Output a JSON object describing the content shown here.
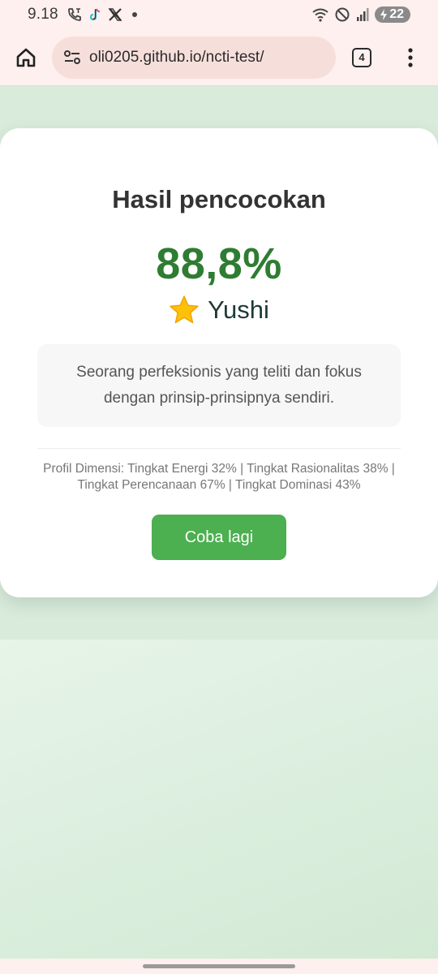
{
  "status_bar": {
    "time": "9.18",
    "battery": "22",
    "left_icons": [
      "call-icon",
      "tiktok-icon",
      "x-icon",
      "dot-icon"
    ],
    "right_icons": [
      "wifi-icon",
      "do-not-disturb-icon",
      "signal-icon",
      "battery-icon"
    ]
  },
  "browser": {
    "url": "oli0205.github.io/ncti-test/",
    "tab_count": "4"
  },
  "result": {
    "title": "Hasil pencocokan",
    "score": "88,8%",
    "name": "Yushi",
    "description": "Seorang perfeksionis yang teliti dan fokus dengan prinsip-prinsipnya sendiri.",
    "profile": "Profil Dimensi: Tingkat Energi 32% | Tingkat Rasionalitas 38% | Tingkat Perencanaan 67% | Tingkat Dominasi 43%",
    "retry_label": "Coba lagi"
  },
  "colors": {
    "score": "#2e7d32",
    "button": "#4caf50",
    "page_bg": "#d9ecdc"
  }
}
